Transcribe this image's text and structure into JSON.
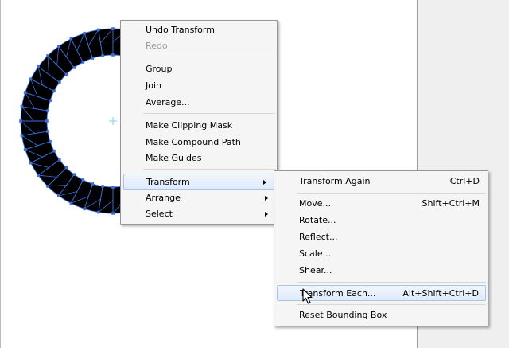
{
  "context_menu": {
    "items": [
      {
        "label": "Undo Transform"
      },
      {
        "label": "Redo",
        "disabled": true
      },
      {
        "label": "Group"
      },
      {
        "label": "Join"
      },
      {
        "label": "Average..."
      },
      {
        "label": "Make Clipping Mask"
      },
      {
        "label": "Make Compound Path"
      },
      {
        "label": "Make Guides"
      },
      {
        "label": "Transform"
      },
      {
        "label": "Arrange"
      },
      {
        "label": "Select"
      }
    ]
  },
  "transform_submenu": {
    "items": [
      {
        "label": "Transform Again",
        "shortcut": "Ctrl+D"
      },
      {
        "label": "Move...",
        "shortcut": "Shift+Ctrl+M"
      },
      {
        "label": "Rotate...",
        "shortcut": ""
      },
      {
        "label": "Reflect...",
        "shortcut": ""
      },
      {
        "label": "Scale...",
        "shortcut": ""
      },
      {
        "label": "Shear...",
        "shortcut": ""
      },
      {
        "label": "Transform Each...",
        "shortcut": "Alt+Shift+Ctrl+D"
      },
      {
        "label": "Reset Bounding Box",
        "shortcut": ""
      }
    ]
  },
  "colors": {
    "selection_blue": "#3c6fd8",
    "highlight_border": "#a9c4ea",
    "art_fill": "#000000",
    "center_point": "#7fd2f0"
  },
  "icons": {
    "cursor": "arrow-pointer-icon",
    "center": "center-point-icon"
  }
}
